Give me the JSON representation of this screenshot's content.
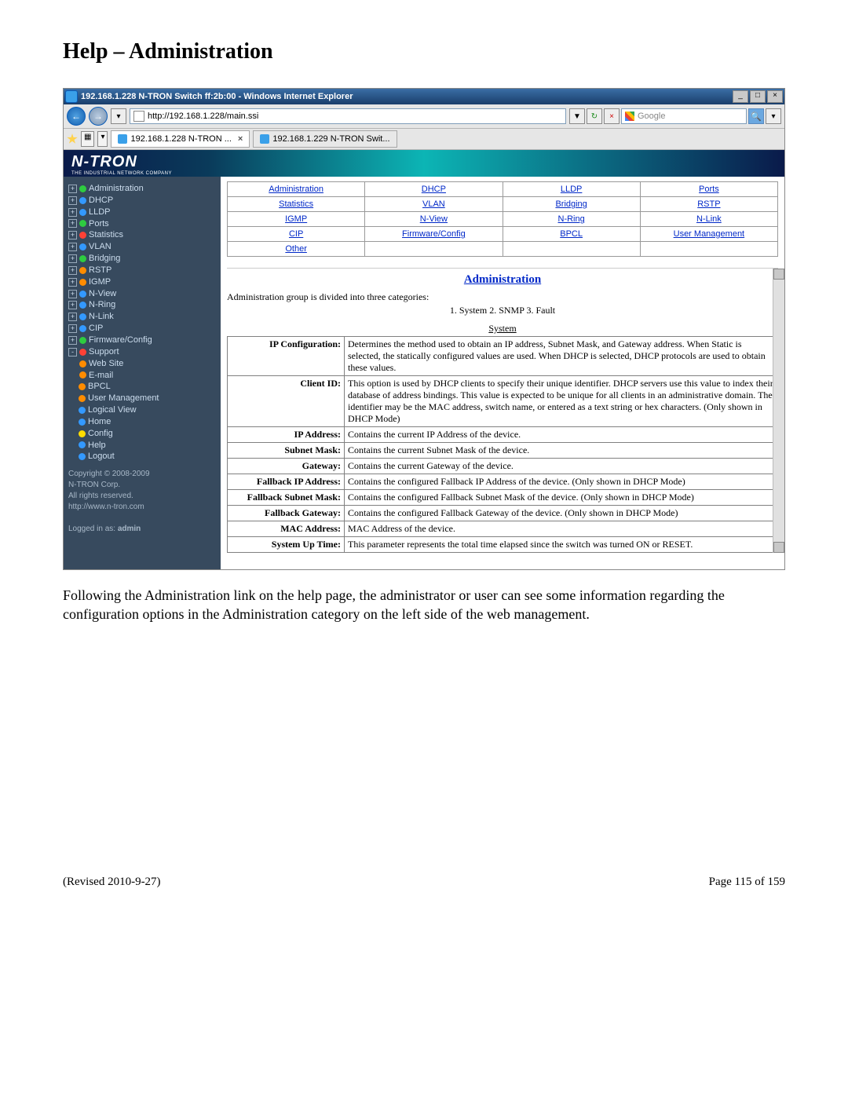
{
  "doc": {
    "title": "Help – Administration",
    "paragraph": "Following the Administration link on the help page, the administrator or user can see some information regarding the configuration options in the Administration category on the left side of the web management.",
    "footer_left": "(Revised 2010-9-27)",
    "footer_right": "Page 115 of 159"
  },
  "window": {
    "title": "192.168.1.228 N-TRON Switch ff:2b:00 - Windows Internet Explorer",
    "min": "_",
    "max": "□",
    "close": "×",
    "back": "←",
    "fwd": "→",
    "menu": "▾",
    "url": "http://192.168.1.228/main.ssi",
    "addr_drop": "▼",
    "refresh": "↻",
    "stop": "×",
    "search_placeholder": "Google",
    "magnify": "🔍",
    "search_drop": "▾",
    "tab1": "192.168.1.228 N-TRON ...",
    "tab2": "192.168.1.229 N-TRON Swit...",
    "tab_close": "×",
    "tabs_drop": "▾"
  },
  "brand": {
    "logo": "N-TRON",
    "sub": "THE INDUSTRIAL NETWORK COMPANY"
  },
  "nav": {
    "items": [
      {
        "exp": "+",
        "bc": "c-green",
        "label": "Administration"
      },
      {
        "exp": "+",
        "bc": "c-blue",
        "label": "DHCP"
      },
      {
        "exp": "+",
        "bc": "c-blue",
        "label": "LLDP"
      },
      {
        "exp": "+",
        "bc": "c-green",
        "label": "Ports"
      },
      {
        "exp": "+",
        "bc": "c-red",
        "label": "Statistics"
      },
      {
        "exp": "+",
        "bc": "c-blue",
        "label": "VLAN"
      },
      {
        "exp": "+",
        "bc": "c-green",
        "label": "Bridging"
      },
      {
        "exp": "+",
        "bc": "c-orange",
        "label": "RSTP"
      },
      {
        "exp": "+",
        "bc": "c-orange",
        "label": "IGMP"
      },
      {
        "exp": "+",
        "bc": "c-blue",
        "label": "N-View"
      },
      {
        "exp": "+",
        "bc": "c-blue",
        "label": "N-Ring"
      },
      {
        "exp": "+",
        "bc": "c-blue",
        "label": "N-Link"
      },
      {
        "exp": "+",
        "bc": "c-blue",
        "label": "CIP"
      },
      {
        "exp": "+",
        "bc": "c-green",
        "label": "Firmware/Config"
      },
      {
        "exp": "-",
        "bc": "c-red",
        "label": "Support"
      }
    ],
    "sub": [
      {
        "bc": "c-orange",
        "label": "Web Site"
      },
      {
        "bc": "c-orange",
        "label": "E-mail"
      }
    ],
    "tail": [
      {
        "bc": "c-orange",
        "label": "BPCL"
      },
      {
        "bc": "c-orange",
        "label": "User Management"
      },
      {
        "bc": "c-blue",
        "label": "Logical View"
      },
      {
        "bc": "c-blue",
        "label": "Home"
      },
      {
        "bc": "c-yellow",
        "label": "Config"
      },
      {
        "bc": "c-blue",
        "label": "Help"
      },
      {
        "bc": "c-blue",
        "label": "Logout"
      }
    ],
    "copyright1": "Copyright © 2008-2009",
    "copyright2": "N-TRON Corp.",
    "rights": "All rights reserved.",
    "site": "http://www.n-tron.com",
    "logged_pre": "Logged in as: ",
    "logged_user": "admin"
  },
  "help_links": [
    [
      "Administration",
      "DHCP",
      "LLDP",
      "Ports"
    ],
    [
      "Statistics",
      "VLAN",
      "Bridging",
      "RSTP"
    ],
    [
      "IGMP",
      "N-View",
      "N-Ring",
      "N-Link"
    ],
    [
      "CIP",
      "Firmware/Config",
      "BPCL",
      "User Management"
    ],
    [
      "Other",
      "",
      "",
      ""
    ]
  ],
  "admin": {
    "header": "Administration",
    "intro": "Administration group is divided into three categories:",
    "cats": "1. System   2. SNMP   3. Fault",
    "sys_head": "System",
    "rows": [
      {
        "k": "IP Configuration:",
        "v": "Determines the method used to obtain an IP address, Subnet Mask, and Gateway address. When Static is selected, the statically configured values are used. When DHCP is selected, DHCP protocols are used to obtain these values."
      },
      {
        "k": "Client ID:",
        "v": "This option is used by DHCP clients to specify their unique identifier. DHCP servers use this value to index their database of address bindings. This value is expected to be unique for all clients in an administrative domain. The identifier may be the MAC address, switch name, or entered as a text string or hex characters. (Only shown in DHCP Mode)"
      },
      {
        "k": "IP Address:",
        "v": "Contains the current IP Address of the device."
      },
      {
        "k": "Subnet Mask:",
        "v": "Contains the current Subnet Mask of the device."
      },
      {
        "k": "Gateway:",
        "v": "Contains the current Gateway of the device."
      },
      {
        "k": "Fallback IP Address:",
        "v": "Contains the configured Fallback IP Address of the device. (Only shown in DHCP Mode)"
      },
      {
        "k": "Fallback Subnet Mask:",
        "v": "Contains the configured Fallback Subnet Mask of the device. (Only shown in DHCP Mode)"
      },
      {
        "k": "Fallback Gateway:",
        "v": "Contains the configured Fallback Gateway of the device. (Only shown in DHCP Mode)"
      },
      {
        "k": "MAC Address:",
        "v": "MAC Address of the device."
      },
      {
        "k": "System Up Time:",
        "v": "This parameter represents the total time elapsed since the switch was turned ON or RESET."
      }
    ]
  }
}
